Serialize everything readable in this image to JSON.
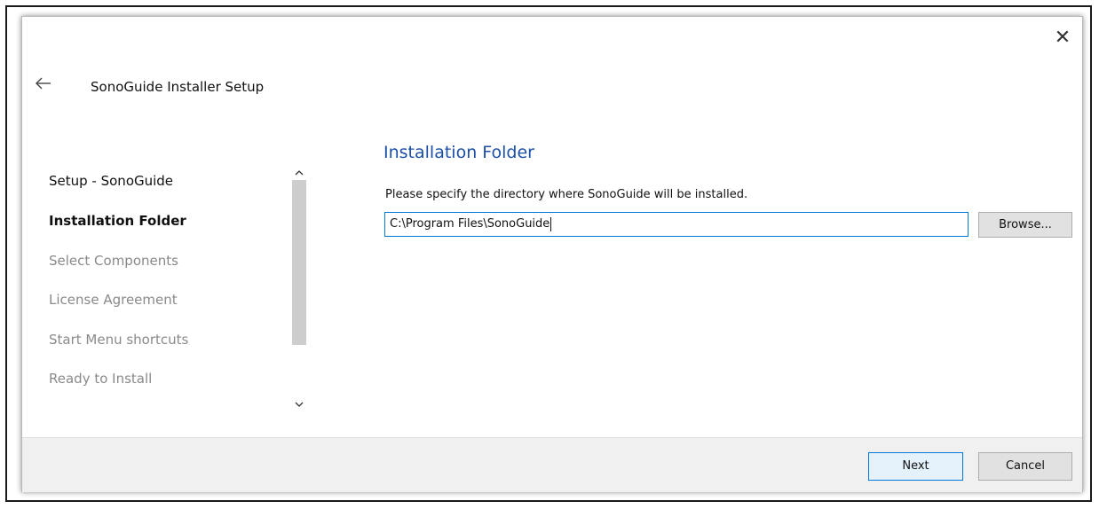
{
  "window": {
    "title": "SonoGuide Installer Setup",
    "close_glyph": "✕"
  },
  "sidebar": {
    "items": [
      {
        "label": "Setup - SonoGuide",
        "state": "done"
      },
      {
        "label": "Installation Folder",
        "state": "active"
      },
      {
        "label": "Select Components",
        "state": "pending"
      },
      {
        "label": "License Agreement",
        "state": "pending"
      },
      {
        "label": "Start Menu shortcuts",
        "state": "pending"
      },
      {
        "label": "Ready to Install",
        "state": "pending"
      }
    ]
  },
  "page": {
    "heading": "Installation Folder",
    "description": "Please specify the directory where SonoGuide will be installed.",
    "path_value": "C:\\Program Files\\SonoGuide",
    "browse_label": "Browse..."
  },
  "footer": {
    "next_label": "Next",
    "cancel_label": "Cancel"
  },
  "icons": {
    "back": "back-arrow-icon",
    "close": "close-icon",
    "scroll_up": "chevron-up-icon",
    "scroll_down": "chevron-down-icon"
  },
  "colors": {
    "heading": "#1c4fa8",
    "accent": "#0078d7",
    "inactive_step": "#8a8a8a"
  }
}
